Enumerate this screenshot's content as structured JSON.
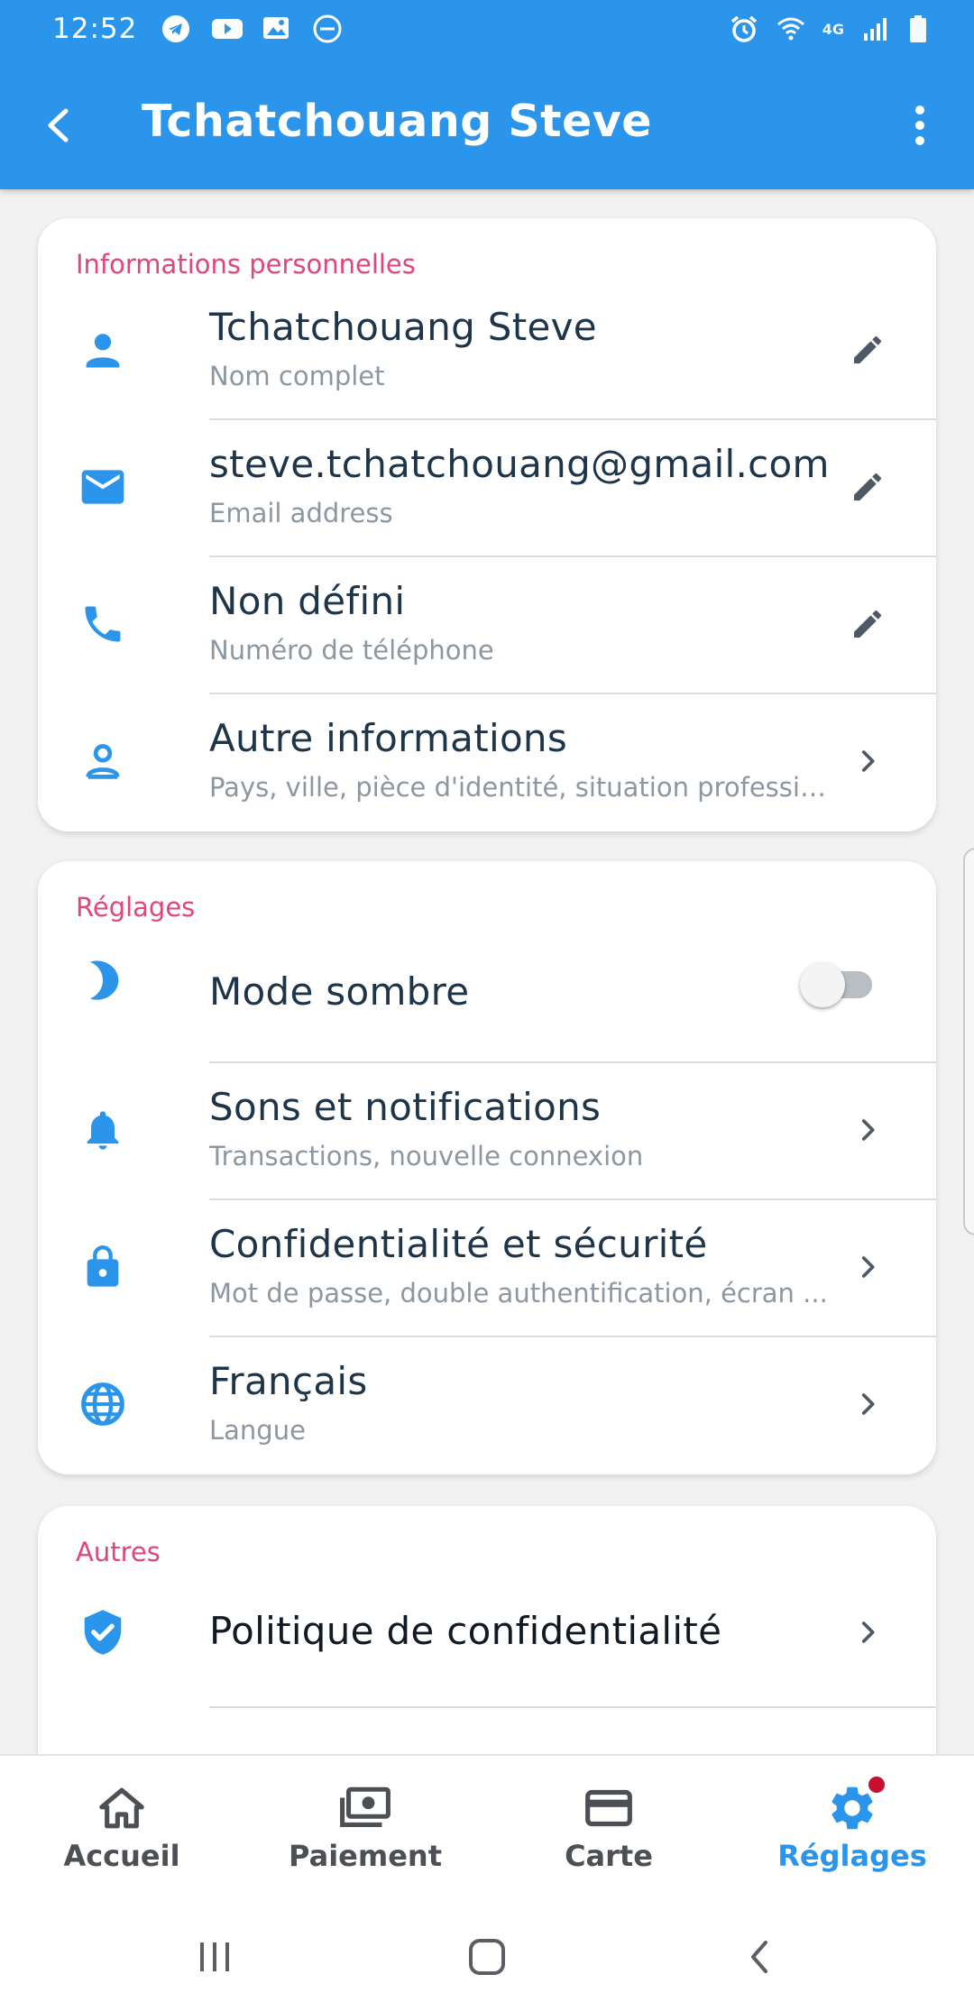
{
  "status_bar": {
    "time": "12:52",
    "network": "4G"
  },
  "header": {
    "title": "Tchatchouang Steve"
  },
  "personal": {
    "section_title": "Informations personnelles",
    "items": [
      {
        "primary": "Tchatchouang Steve",
        "secondary": "Nom complet",
        "icon": "person-icon",
        "action": "edit-icon"
      },
      {
        "primary": "steve.tchatchouang@gmail.com",
        "secondary": "Email address",
        "icon": "email-icon",
        "action": "edit-icon"
      },
      {
        "primary": "Non défini",
        "secondary": "Numéro de téléphone",
        "icon": "phone-icon",
        "action": "edit-icon"
      },
      {
        "primary": "Autre informations",
        "secondary": "Pays, ville, pièce d'identité, situation professio...",
        "icon": "person-outline-icon",
        "action": "chevron-right-icon"
      }
    ]
  },
  "settings": {
    "section_title": "Réglages",
    "dark_mode": {
      "label": "Mode sombre",
      "enabled": false
    },
    "items": [
      {
        "primary": "Sons et notifications",
        "secondary": "Transactions, nouvelle connexion",
        "icon": "bell-icon"
      },
      {
        "primary": "Confidentialité et sécurité",
        "secondary": "Mot de passe, double authentification, écran ...",
        "icon": "lock-icon"
      },
      {
        "primary": "Français",
        "secondary": "Langue",
        "icon": "globe-icon"
      }
    ]
  },
  "others": {
    "section_title": "Autres",
    "items": [
      {
        "primary": "Politique de confidentialité",
        "icon": "shield-check-icon"
      }
    ]
  },
  "bottom_nav": {
    "items": [
      {
        "label": "Accueil",
        "icon": "home-icon",
        "active": false
      },
      {
        "label": "Paiement",
        "icon": "payment-icon",
        "active": false
      },
      {
        "label": "Carte",
        "icon": "card-icon",
        "active": false
      },
      {
        "label": "Réglages",
        "icon": "gear-icon",
        "active": true,
        "badge": true
      }
    ]
  },
  "colors": {
    "primary": "#2a95ea",
    "section_title": "#e0467a",
    "badge": "#c8102e"
  }
}
